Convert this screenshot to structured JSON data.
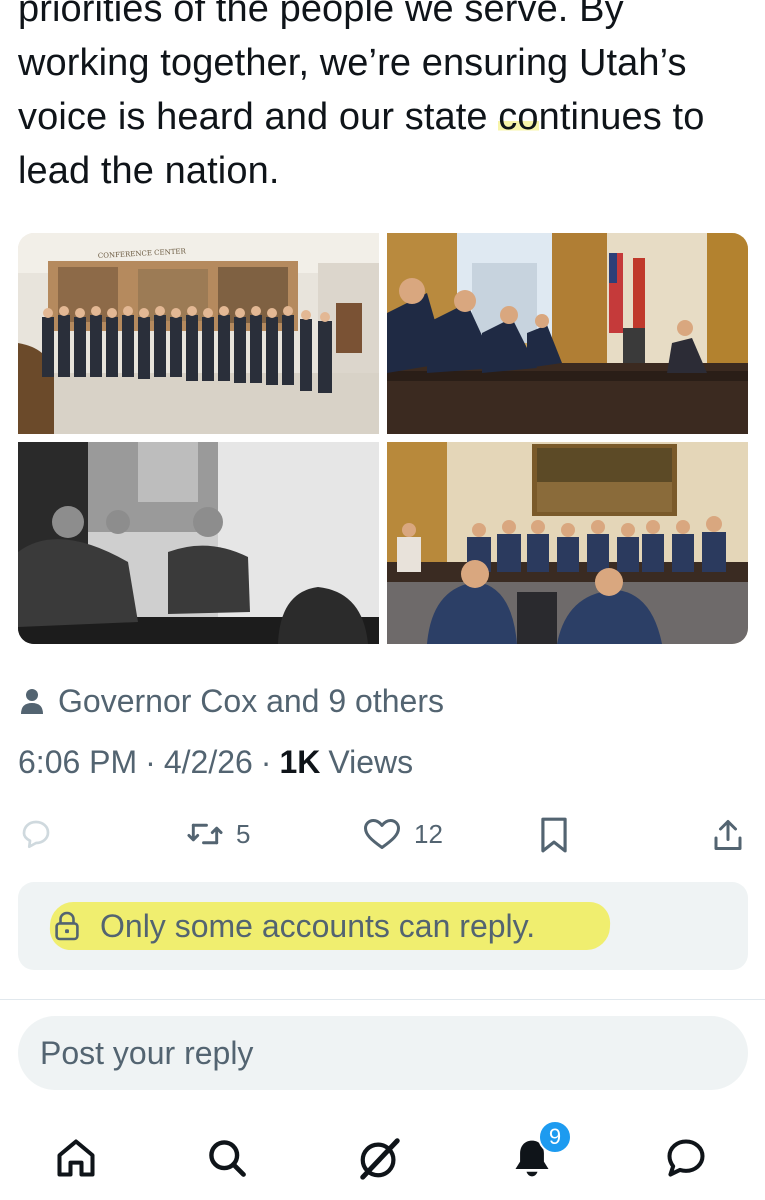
{
  "tweet": {
    "text_lines": [
      "priorities of the people we serve. By",
      "working together, we’re ensuring Utah’s",
      "voice is heard and our state continues to",
      "lead the nation."
    ],
    "line3_part1": "voice is heard and our state ",
    "line3_highlight": "co",
    "line3_part2": "ntinues to"
  },
  "media": {
    "photos": [
      {
        "icon": "group-photo",
        "sign_text": "CONFERENCE CENTER"
      },
      {
        "icon": "meeting-photo"
      },
      {
        "icon": "bw-meeting-photo"
      },
      {
        "icon": "meeting-room-photo"
      }
    ]
  },
  "tagged": {
    "label": "Governor Cox and 9 others",
    "icon": "person-icon"
  },
  "meta": {
    "time": "6:06 PM",
    "date": "4/2/26",
    "views_count": "1K",
    "views_label": "Views"
  },
  "actions": {
    "reply_icon": "reply-icon",
    "retweet_count": "5",
    "like_count": "12",
    "bookmark_icon": "bookmark-icon",
    "share_icon": "share-icon"
  },
  "reply_restriction": {
    "text": "Only some accounts can reply.",
    "icon": "lock-icon",
    "highlight_color": "#f0eb3c"
  },
  "reply_input": {
    "placeholder": "Post your reply"
  },
  "tabbar": {
    "items": [
      "home-icon",
      "search-icon",
      "grok-icon",
      "notifications-icon",
      "messages-icon"
    ],
    "notification_badge": "9"
  },
  "colors": {
    "text": "#0f1419",
    "secondary": "#536471",
    "accent": "#1d9bf0",
    "surface": "#eff3f4"
  }
}
